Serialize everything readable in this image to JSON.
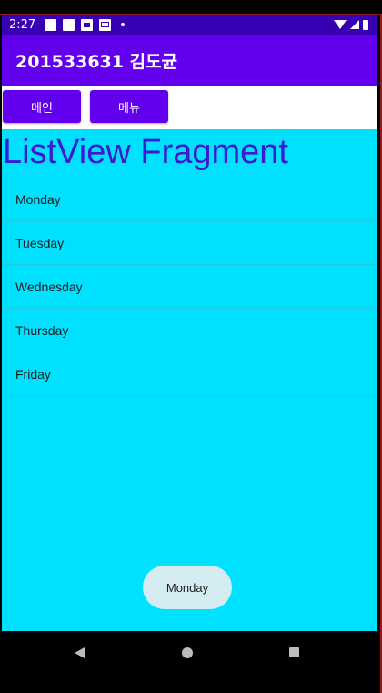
{
  "status_bar": {
    "time": "2:27"
  },
  "app_bar": {
    "title": "201533631 김도균"
  },
  "buttons": {
    "main": "메인",
    "menu": "메뉴"
  },
  "fragment": {
    "title": "ListView Fragment",
    "items": [
      "Monday",
      "Tuesday",
      "Wednesday",
      "Thursday",
      "Friday"
    ]
  },
  "toast": {
    "text": "Monday"
  },
  "colors": {
    "status_bar": "#3700b3",
    "app_bar": "#6200ee",
    "button": "#6200ee",
    "content_background": "#00e1ff",
    "title_text": "#3b1ad3",
    "toast_background": "#d4ecf2"
  },
  "icons": {
    "status": [
      "notification-icon",
      "notification-icon",
      "photo-icon",
      "mail-icon",
      "dot-icon",
      "wifi-icon",
      "signal-icon",
      "battery-icon"
    ],
    "nav": [
      "back-icon",
      "home-icon",
      "recents-icon"
    ]
  }
}
